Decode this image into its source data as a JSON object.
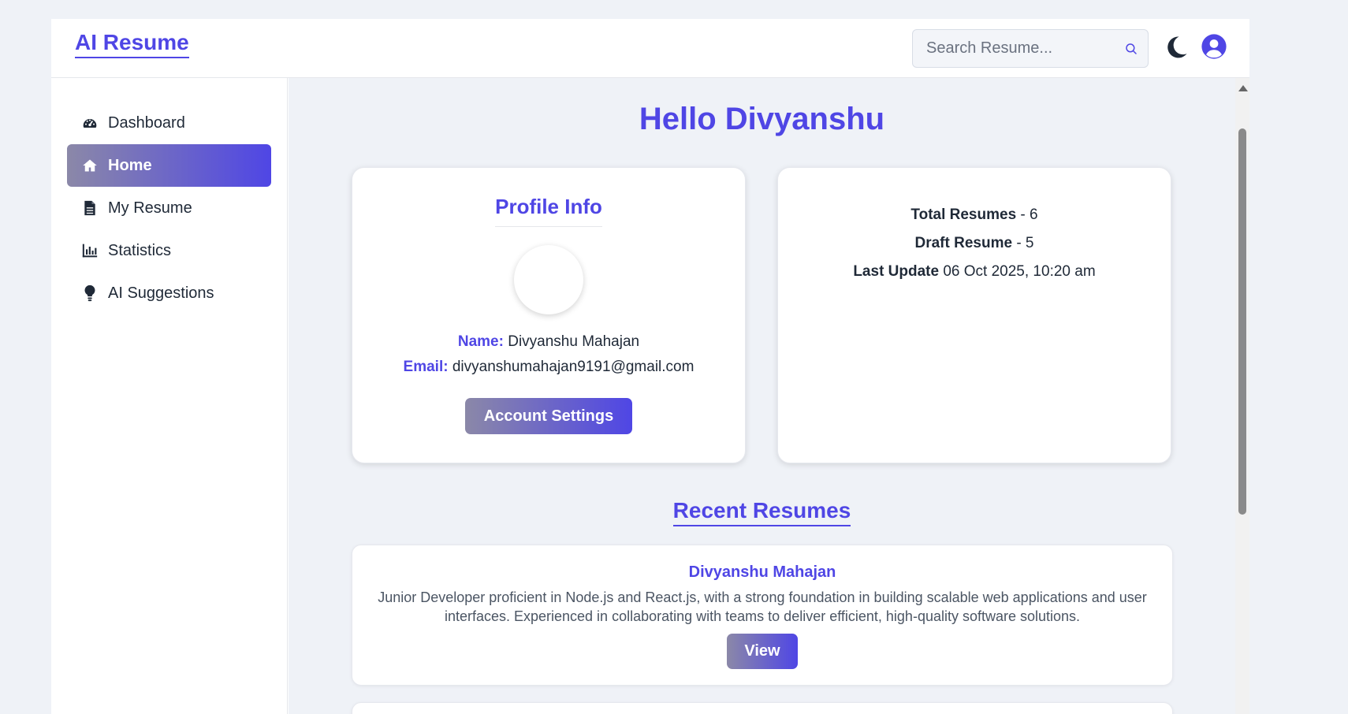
{
  "brand": "AI Resume",
  "search": {
    "placeholder": "Search Resume..."
  },
  "sidebar": {
    "items": [
      {
        "label": "Dashboard",
        "icon": "gauge-icon"
      },
      {
        "label": "Home",
        "icon": "home-icon",
        "active": true
      },
      {
        "label": "My Resume",
        "icon": "file-icon"
      },
      {
        "label": "Statistics",
        "icon": "bar-chart-icon"
      },
      {
        "label": "AI Suggestions",
        "icon": "lightbulb-icon"
      }
    ]
  },
  "main": {
    "greeting": "Hello Divyanshu",
    "profile": {
      "title": "Profile Info",
      "name_label": "Name:",
      "name": "Divyanshu Mahajan",
      "email_label": "Email:",
      "email": "divyanshumahajan9191@gmail.com",
      "settings_button": "Account Settings"
    },
    "stats": {
      "total_label": "Total Resumes",
      "total_value": " - 6",
      "draft_label": "Draft Resume",
      "draft_value": " - 5",
      "update_label": "Last Update",
      "update_value": " 06 Oct 2025, 10:20 am"
    },
    "recent_title": "Recent Resumes",
    "recent": [
      {
        "name": "Divyanshu Mahajan",
        "description": "Junior Developer proficient in Node.js and React.js, with a strong foundation in building scalable web applications and user interfaces. Experienced in collaborating with teams to deliver efficient, high-quality software solutions.",
        "button": "View"
      }
    ]
  },
  "colors": {
    "accent": "#4f46e5",
    "gradient_start": "#8b88a8",
    "background": "#eff2f7"
  }
}
